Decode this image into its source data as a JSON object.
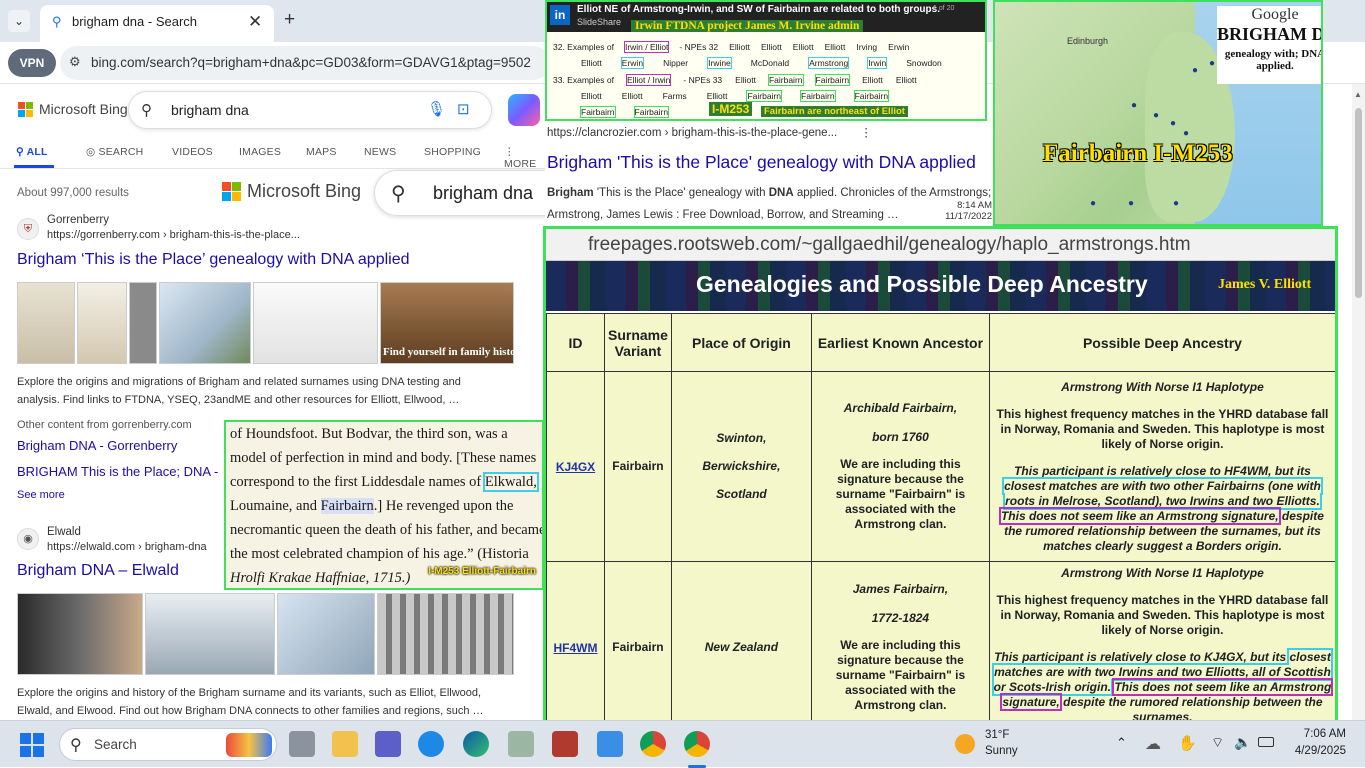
{
  "browser": {
    "tab_title": "brigham dna - Search",
    "url": "bing.com/search?q=brigham+dna&pc=GD03&form=GDAVG1&ptag=9502",
    "vpn_label": "VPN"
  },
  "bing": {
    "logo": "Microsoft Bing",
    "query": "brigham dna",
    "nav": [
      "ALL",
      "SEARCH",
      "VIDEOS",
      "IMAGES",
      "MAPS",
      "NEWS",
      "SHOPPING",
      "MORE"
    ],
    "results_count": "About 997,000 results",
    "overlay_logo": "Microsoft Bing",
    "overlay_query": "brigham dna",
    "result1": {
      "site_name": "Gorrenberry",
      "url": "https://gorrenberry.com › brigham-this-is-the-place...",
      "title": "Brigham ‘This is the Place’ genealogy with DNA applied",
      "snippet": "Explore the origins and migrations of Brigham and related surnames using DNA testing and analysis. Find links to FTDNA, YSEQ, 23andME and other resources for Elliott, Ellwood, …",
      "thumb_caption": "Find yourself in family history"
    },
    "other_from": "Other content from gorrenberry.com",
    "sublink1": "Brigham DNA - Gorrenberry",
    "sublink2": "BRIGHAM This is the Place; DNA -",
    "see_more": "See more",
    "result2": {
      "site_name": "Elwald",
      "url": "https://elwald.com › brigham-dna",
      "title": "Brigham DNA – Elwald",
      "snippet": "Explore the origins and history of the Brigham surname and its variants, such as Elliot, Ellwood, Elwald, and Elwood. Find out how Brigham DNA connects to other families and regions, such …"
    }
  },
  "quote_panel": {
    "line1": "of Houndsfoot. But Bodvar, the third son, was a",
    "line2": "model of perfection in mind and body. [These names",
    "line3a": "correspond to the first Liddesdale names of ",
    "line3b": "Elkwald,",
    "line4a": "Loumaine, and ",
    "line4b": "Fairbairn",
    "line4c": ".] He revenged upon the",
    "line5": "necromantic queen the death of his father, and became",
    "line6": "the most celebrated champion of his age.” (Historia",
    "line7": "Hrolfi Krakae Haffniae, 1715.)",
    "tag": "I-M253 Elliott-Fairbairn"
  },
  "slide_panel": {
    "header": "Elliot NE of Armstrong-Irwin, and SW of Fairbairn are related to both groups.",
    "subheader": "Irwin FTDNA project James M. Irvine admin",
    "slideshare": "SlideShare",
    "pager": "1 of 20",
    "row32": [
      "32. Examples of",
      "Irwin / Elliot",
      "- NPEs 32",
      "Elliott",
      "Elliott",
      "Elliott",
      "Elliott",
      "Irving",
      "Erwin"
    ],
    "row32b": [
      "Elliott",
      "Erwin",
      "Nipper",
      "Irwine",
      "McDonald",
      "Armstrong",
      "Irwin",
      "Snowdon"
    ],
    "row33": [
      "33. Examples of",
      "Elliot / Irwin",
      "- NPEs 33",
      "Elliott",
      "Fairbairn",
      "Fairbairn",
      "Elliott",
      "Elliott"
    ],
    "row33b": [
      "Elliott",
      "Elliott",
      "Farms",
      "Elliott",
      "Fairbairn",
      "Fairbairn",
      "Fairbairn"
    ],
    "row33c": [
      "Fairbairn",
      "Fairbairn"
    ],
    "tag": "I-M253",
    "tag2": "Fairbairn are northeast of Elliot"
  },
  "result3": {
    "url": "https://clancrozier.com › brigham-this-is-the-place-gene...",
    "title": "Brigham 'This is the Place' genealogy with DNA applied",
    "snippet_b1": "Brigham",
    "snippet_1": " 'This is the Place' genealogy with ",
    "snippet_b2": "DNA",
    "snippet_2": " applied. Chronicles of the Armstrongs;",
    "snippet_3": "Armstrong, James Lewis : Free Download, Borrow, and Streaming …",
    "time": "8:14 AM",
    "date": "11/17/2022"
  },
  "map_panel": {
    "brand_google": "Google",
    "brand_main": "BRIGHAM DNA",
    "brand_sub": "genealogy with; DNA applied.",
    "city": "Edinburgh",
    "label": "Fairbairn I-M253"
  },
  "table_panel": {
    "url": "freepages.rootsweb.com/~gallgaedhil/genealogy/haplo_armstrongs.htm",
    "title": "Genealogies and Possible Deep Ancestry",
    "author": "James V. Elliott",
    "headers": [
      "ID",
      "Surname Variant",
      "Place of Origin",
      "Earliest Known Ancestor",
      "Possible Deep Ancestry"
    ],
    "rows": [
      {
        "id": "KJ4GX",
        "surname": "Fairbairn",
        "origin": [
          "Swinton,",
          "Berwickshire,",
          "Scotland"
        ],
        "ancestor": "Archibald Fairbairn,",
        "born": "born 1760",
        "including": "We are including this signature because the surname \"Fairbairn\" is associated with the Armstrong clan.",
        "deep_title": "Armstrong With Norse I1 Haplotype",
        "deep_p1": "This highest frequency matches in the YHRD database fall in Norway, Romania and Sweden. This haplotype is most likely of Norse origin.",
        "deep_p2a": "This participant is relatively close to HF4WM, but its ",
        "deep_p2b": "closest matches are with two other Fairbairns (one with roots in Melrose, Scotland), two Irwins and two Elliotts.",
        "deep_p2c": "This does not seem like an Armstrong signature,",
        "deep_p2d": " despite the rumored relationship between the surnames, but its matches clearly suggest a Borders origin."
      },
      {
        "id": "HF4WM",
        "surname": "Fairbairn",
        "origin": [
          "New Zealand"
        ],
        "ancestor": "James Fairbairn,",
        "born": "1772-1824",
        "including": "We are including this signature because the surname \"Fairbairn\" is associated with the Armstrong clan.",
        "deep_title": "Armstrong With Norse I1 Haplotype",
        "deep_p1": "This highest frequency matches in the YHRD database fall in Norway, Romania and Sweden. This haplotype is most likely of Norse origin.",
        "deep_p2a": "This participant is relatively close to KJ4GX, but its ",
        "deep_p2b": "closest matches are with two Irwins and two Elliotts, all of Scottish or Scots-Irish origin.",
        "deep_p2c": "This does not seem like an Armstrong signature,",
        "deep_p2d": " despite the rumored relationship between the surnames."
      }
    ]
  },
  "taskbar": {
    "search": "Search",
    "temp": "31°F",
    "weather": "Sunny",
    "time": "7:06 AM",
    "date": "4/29/2025"
  },
  "colors": {
    "link": "#1a0dab",
    "panel_border": "#3fe05a",
    "highlight_cyan": "#3ad0e8",
    "highlight_magenta": "#c02ec0",
    "table_bg": "#f3f7c9"
  }
}
